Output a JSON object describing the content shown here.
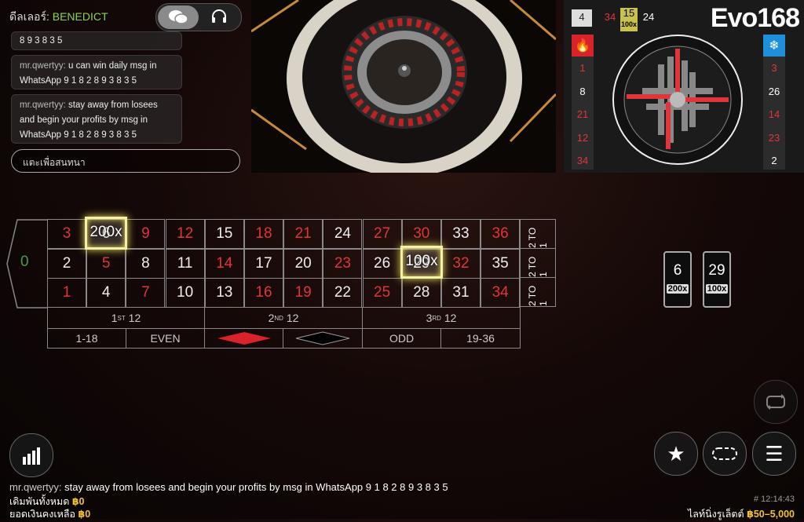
{
  "dealer": {
    "label": "ดีลเลอร์:",
    "name": "BENEDICT"
  },
  "chat": {
    "partial": "8 9 3 8 3 5",
    "messages": [
      {
        "user": "mr.qwertyy:",
        "text": "u can win daily msg in WhatsApp 9 1 8 2 8 9 3 8 3 5"
      },
      {
        "user": "mr.qwertyy:",
        "text": "stay away from losees and begin your profits by msg in WhatsApp 9 1 8 2 8 9 3 8 3 5"
      }
    ],
    "input_placeholder": "แตะเพื่อสนทนา",
    "ticker_user": "mr.qwertyy:",
    "ticker_text": "stay away from losees and begin your profits by msg in WhatsApp 9 1 8 2 8 9 3 8 3 5"
  },
  "stats": {
    "logo": "Evo168",
    "last_numbers": [
      {
        "value": "4",
        "color": "#dddddd"
      },
      {
        "value": "34",
        "color": "#e0353a"
      },
      {
        "value": "15",
        "mult": "100x",
        "color": "#000000"
      },
      {
        "value": "24",
        "color": "#ffffff"
      }
    ],
    "hot": [
      "1",
      "8",
      "21",
      "12",
      "34"
    ],
    "cold": [
      "3",
      "26",
      "14",
      "23",
      "2"
    ],
    "hot_colors": [
      "#e0353a",
      "#ffffff",
      "#e0353a",
      "#e0353a",
      "#e0353a"
    ],
    "cold_colors": [
      "#e0353a",
      "#ffffff",
      "#e0353a",
      "#e0353a",
      "#ffffff"
    ]
  },
  "table": {
    "zero": "0",
    "rows": [
      [
        "3",
        "6",
        "9",
        "12",
        "15",
        "18",
        "21",
        "24",
        "27",
        "30",
        "33",
        "36"
      ],
      [
        "2",
        "5",
        "8",
        "11",
        "14",
        "17",
        "20",
        "23",
        "26",
        "29",
        "32",
        "35"
      ],
      [
        "1",
        "4",
        "7",
        "10",
        "13",
        "16",
        "19",
        "22",
        "25",
        "28",
        "31",
        "34"
      ]
    ],
    "red_numbers": [
      "1",
      "3",
      "5",
      "7",
      "9",
      "12",
      "14",
      "16",
      "18",
      "19",
      "21",
      "23",
      "25",
      "27",
      "30",
      "32",
      "34",
      "36"
    ],
    "two_to_one": "2 TO 1",
    "dozens": [
      {
        "n": "1",
        "sup": "ST",
        "t": "12"
      },
      {
        "n": "2",
        "sup": "ND",
        "t": "12"
      },
      {
        "n": "3",
        "sup": "RD",
        "t": "12"
      }
    ],
    "outside": {
      "low": "1-18",
      "even": "EVEN",
      "odd": "ODD",
      "high": "19-36"
    },
    "highlights": [
      {
        "label": "200x"
      },
      {
        "label": "100x"
      }
    ]
  },
  "multipliers": [
    {
      "number": "6",
      "mult": "200x"
    },
    {
      "number": "29",
      "mult": "100x"
    }
  ],
  "balance": {
    "total_bet_label": "เดิมพันทั้งหมด",
    "total_bet": "฿0",
    "balance_label": "ยอดเงินคงเหลือ",
    "balance": "฿0",
    "round": "# 12:14:43",
    "limits_label": "ไลท์นิ่งรูเล็ตต์",
    "limits": "฿50–5,000"
  },
  "colors": {
    "red": "#e0353a",
    "highlight": "#f3f0a8",
    "green": "#8fd44a",
    "gold": "#f2c230"
  }
}
